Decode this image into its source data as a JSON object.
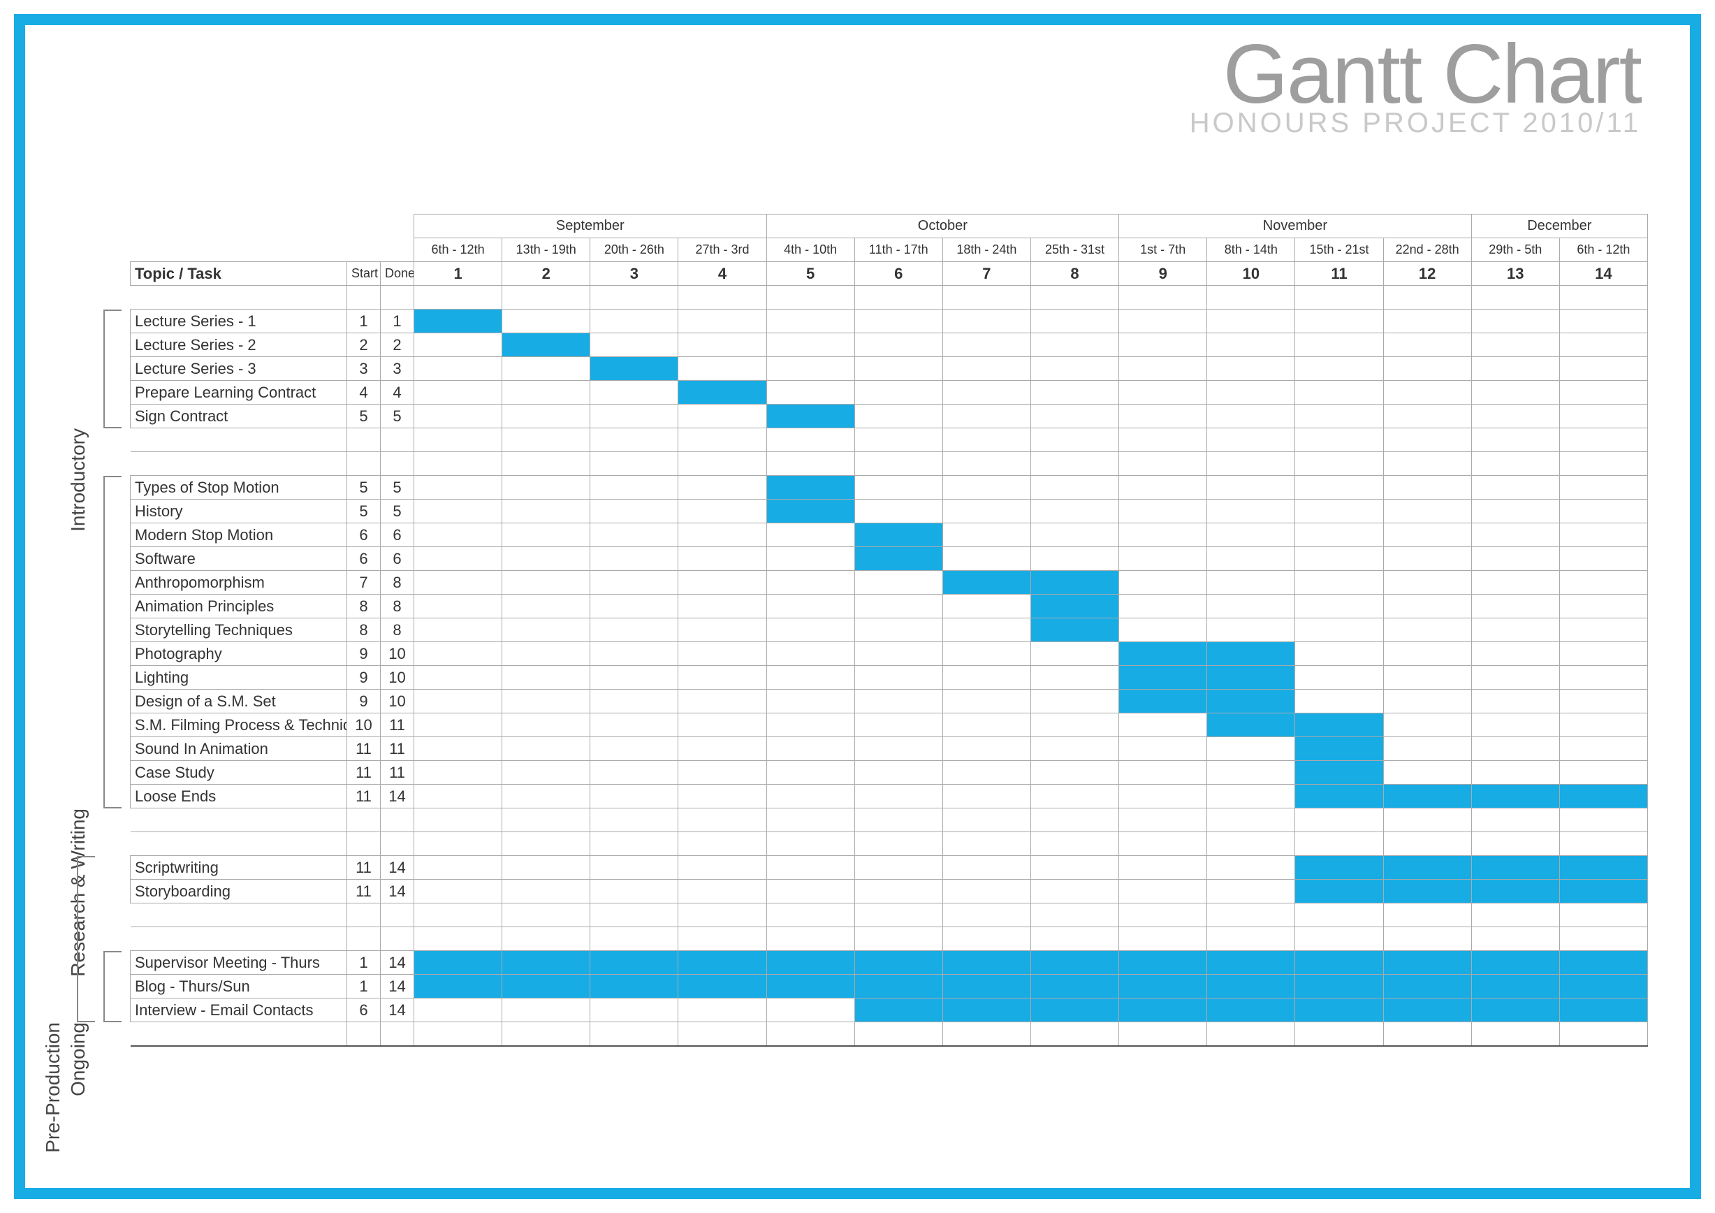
{
  "title": "Gantt Chart",
  "subtitle": "HONOURS PROJECT 2010/11",
  "columns": {
    "task_header": "Topic / Task",
    "start_header": "Start",
    "done_header": "Done"
  },
  "months": [
    {
      "name": "September",
      "span": 4
    },
    {
      "name": "October",
      "span": 4
    },
    {
      "name": "November",
      "span": 4
    },
    {
      "name": "December",
      "span": 2
    }
  ],
  "weeks": [
    {
      "dates": "6th - 12th",
      "num": "1"
    },
    {
      "dates": "13th - 19th",
      "num": "2"
    },
    {
      "dates": "20th - 26th",
      "num": "3"
    },
    {
      "dates": "27th - 3rd",
      "num": "4"
    },
    {
      "dates": "4th - 10th",
      "num": "5"
    },
    {
      "dates": "11th - 17th",
      "num": "6"
    },
    {
      "dates": "18th - 24th",
      "num": "7"
    },
    {
      "dates": "25th - 31st",
      "num": "8"
    },
    {
      "dates": "1st - 7th",
      "num": "9"
    },
    {
      "dates": "8th - 14th",
      "num": "10"
    },
    {
      "dates": "15th - 21st",
      "num": "11"
    },
    {
      "dates": "22nd - 28th",
      "num": "12"
    },
    {
      "dates": "29th - 5th",
      "num": "13"
    },
    {
      "dates": "6th - 12th",
      "num": "14"
    }
  ],
  "groups": [
    {
      "name": "Introductory",
      "tasks": [
        {
          "name": "Lecture Series - 1",
          "start": "1",
          "done": "1"
        },
        {
          "name": "Lecture Series - 2",
          "start": "2",
          "done": "2"
        },
        {
          "name": "Lecture Series - 3",
          "start": "3",
          "done": "3"
        },
        {
          "name": "Prepare Learning Contract",
          "start": "4",
          "done": "4"
        },
        {
          "name": "Sign Contract",
          "start": "5",
          "done": "5"
        }
      ]
    },
    {
      "name": "Research & Writing",
      "tasks": [
        {
          "name": "Types of Stop Motion",
          "start": "5",
          "done": "5"
        },
        {
          "name": "History",
          "start": "5",
          "done": "5"
        },
        {
          "name": "Modern Stop Motion",
          "start": "6",
          "done": "6"
        },
        {
          "name": "Software",
          "start": "6",
          "done": "6"
        },
        {
          "name": "Anthropomorphism",
          "start": "7",
          "done": "8"
        },
        {
          "name": "Animation Principles",
          "start": "8",
          "done": "8"
        },
        {
          "name": "Storytelling Techniques",
          "start": "8",
          "done": "8"
        },
        {
          "name": "Photography",
          "start": "9",
          "done": "10"
        },
        {
          "name": "Lighting",
          "start": "9",
          "done": "10"
        },
        {
          "name": "Design of a S.M. Set",
          "start": "9",
          "done": "10"
        },
        {
          "name": "S.M. Filming Process & Techniques",
          "start": "10",
          "done": "11"
        },
        {
          "name": "Sound In Animation",
          "start": "11",
          "done": "11"
        },
        {
          "name": "Case Study",
          "start": "11",
          "done": "11"
        },
        {
          "name": "Loose Ends",
          "start": "11",
          "done": "14"
        }
      ]
    },
    {
      "name": "Pre-Production",
      "tasks": [
        {
          "name": "Scriptwriting",
          "start": "11",
          "done": "14"
        },
        {
          "name": "Storyboarding",
          "start": "11",
          "done": "14"
        }
      ]
    },
    {
      "name": "Ongoing",
      "tasks": [
        {
          "name": "Supervisor Meeting - Thurs",
          "start": "1",
          "done": "14"
        },
        {
          "name": "Blog - Thurs/Sun",
          "start": "1",
          "done": "14"
        },
        {
          "name": "Interview - Email Contacts",
          "start": "6",
          "done": "14"
        }
      ]
    }
  ],
  "chart_data": {
    "type": "gantt",
    "title": "Gantt Chart — Honours Project 2010/11",
    "x_unit": "week",
    "x_range": [
      1,
      14
    ],
    "x_labels": [
      "6th-12th Sep",
      "13th-19th Sep",
      "20th-26th Sep",
      "27th-3rd Sep/Oct",
      "4th-10th Oct",
      "11th-17th Oct",
      "18th-24th Oct",
      "25th-31st Oct",
      "1st-7th Nov",
      "8th-14th Nov",
      "15th-21st Nov",
      "22nd-28th Nov",
      "29th-5th Nov/Dec",
      "6th-12th Dec"
    ],
    "series": [
      {
        "group": "Introductory",
        "task": "Lecture Series - 1",
        "start": 1,
        "end": 1
      },
      {
        "group": "Introductory",
        "task": "Lecture Series - 2",
        "start": 2,
        "end": 2
      },
      {
        "group": "Introductory",
        "task": "Lecture Series - 3",
        "start": 3,
        "end": 3
      },
      {
        "group": "Introductory",
        "task": "Prepare Learning Contract",
        "start": 4,
        "end": 4
      },
      {
        "group": "Introductory",
        "task": "Sign Contract",
        "start": 5,
        "end": 5
      },
      {
        "group": "Research & Writing",
        "task": "Types of Stop Motion",
        "start": 5,
        "end": 5
      },
      {
        "group": "Research & Writing",
        "task": "History",
        "start": 5,
        "end": 5
      },
      {
        "group": "Research & Writing",
        "task": "Modern Stop Motion",
        "start": 6,
        "end": 6
      },
      {
        "group": "Research & Writing",
        "task": "Software",
        "start": 6,
        "end": 6
      },
      {
        "group": "Research & Writing",
        "task": "Anthropomorphism",
        "start": 7,
        "end": 8
      },
      {
        "group": "Research & Writing",
        "task": "Animation Principles",
        "start": 8,
        "end": 8
      },
      {
        "group": "Research & Writing",
        "task": "Storytelling Techniques",
        "start": 8,
        "end": 8
      },
      {
        "group": "Research & Writing",
        "task": "Photography",
        "start": 9,
        "end": 10
      },
      {
        "group": "Research & Writing",
        "task": "Lighting",
        "start": 9,
        "end": 10
      },
      {
        "group": "Research & Writing",
        "task": "Design of a S.M. Set",
        "start": 9,
        "end": 10
      },
      {
        "group": "Research & Writing",
        "task": "S.M. Filming Process & Techniques",
        "start": 10,
        "end": 11
      },
      {
        "group": "Research & Writing",
        "task": "Sound In Animation",
        "start": 11,
        "end": 11
      },
      {
        "group": "Research & Writing",
        "task": "Case Study",
        "start": 11,
        "end": 11
      },
      {
        "group": "Research & Writing",
        "task": "Loose Ends",
        "start": 11,
        "end": 14
      },
      {
        "group": "Pre-Production",
        "task": "Scriptwriting",
        "start": 11,
        "end": 14
      },
      {
        "group": "Pre-Production",
        "task": "Storyboarding",
        "start": 11,
        "end": 14
      },
      {
        "group": "Ongoing",
        "task": "Supervisor Meeting - Thurs",
        "start": 1,
        "end": 14
      },
      {
        "group": "Ongoing",
        "task": "Blog - Thurs/Sun",
        "start": 1,
        "end": 14
      },
      {
        "group": "Ongoing",
        "task": "Interview - Email Contacts",
        "start": 6,
        "end": 14
      }
    ]
  }
}
